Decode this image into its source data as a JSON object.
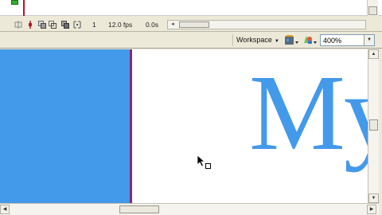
{
  "timeline": {
    "status": {
      "current_frame": "1",
      "frame_rate": "12.0 fps",
      "elapsed_time": "0.0s"
    }
  },
  "edit_bar": {
    "workspace_label": "Workspace",
    "zoom_value": "400%"
  },
  "stage": {
    "text": "My",
    "colors": {
      "fill": "#4399ea",
      "stage_edge": "#8c2a6c",
      "background": "#ffffff"
    }
  },
  "icons": {
    "playhead": "playhead-icon",
    "center_frame": "center-frame-icon",
    "onion_skin": "onion-skin-icon",
    "onion_skin_outlines": "onion-skin-outlines-icon",
    "edit_multiple_frames": "edit-multiple-frames-icon",
    "modify_onion_markers": "modify-onion-markers-icon",
    "edit_symbol": "edit-symbol-icon",
    "edit_scene": "edit-scene-icon",
    "cursor": "arrow-cursor-icon"
  }
}
